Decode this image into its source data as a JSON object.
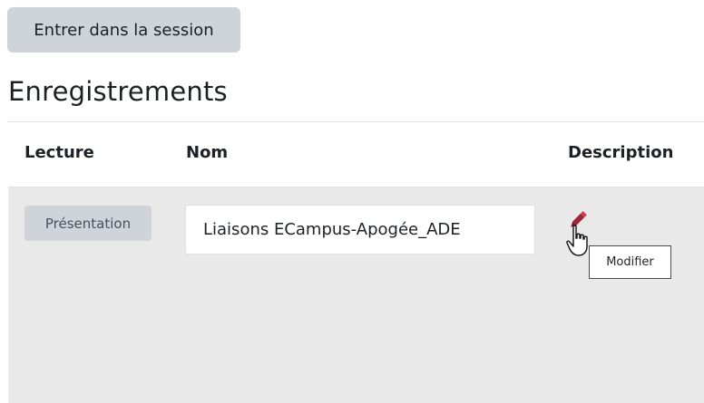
{
  "session": {
    "join_label": "Entrer dans la session"
  },
  "recordings": {
    "title": "Enregistrements",
    "columns": {
      "lecture": "Lecture",
      "nom": "Nom",
      "description": "Description"
    },
    "rows": [
      {
        "playback_label": "Présentation",
        "name_value": "Liaisons ECampus-Apogée_ADE",
        "edit_icon": "pencil-icon"
      }
    ]
  },
  "tooltip": {
    "text": "Modifier"
  },
  "colors": {
    "button_bg": "#ced4da",
    "row_bg": "#e9e9e9",
    "pencil": "#a0253a"
  }
}
